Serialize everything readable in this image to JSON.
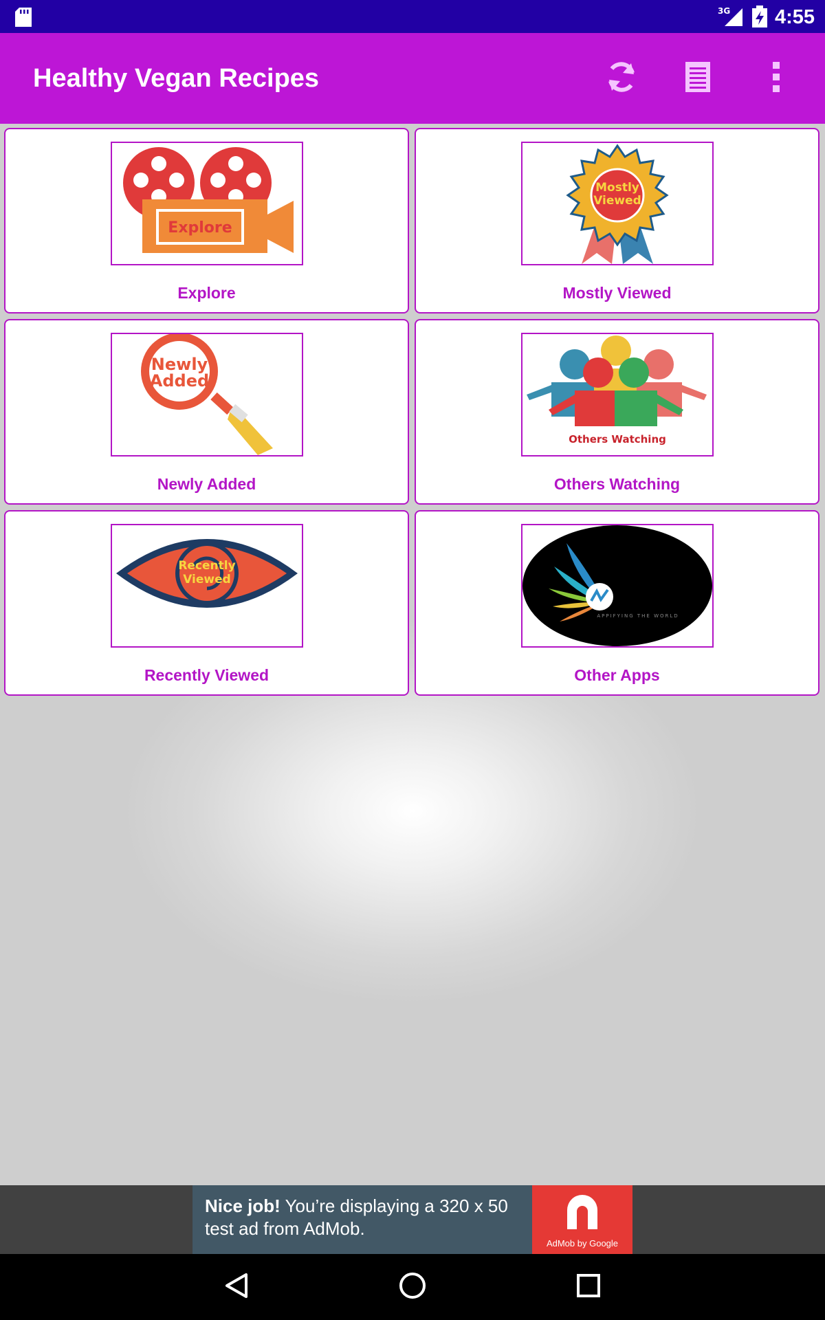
{
  "status_bar": {
    "time": "4:55",
    "network": "3G",
    "bg_color": "#2200a4"
  },
  "app_bar": {
    "title": "Healthy Vegan Recipes",
    "bg_color": "#bd16d6",
    "actions": [
      "refresh-icon",
      "list-icon",
      "more-vertical-icon"
    ]
  },
  "grid": {
    "accent_color": "#b315c6",
    "cards": [
      {
        "label": "Explore",
        "image_text": "Explore",
        "icon": "film-camera-icon"
      },
      {
        "label": "Mostly Viewed",
        "image_text": "Mostly Viewed",
        "icon": "award-ribbon-icon"
      },
      {
        "label": "Newly Added",
        "image_text": "Newly Added",
        "icon": "magnifier-icon"
      },
      {
        "label": "Others Watching",
        "image_text": "Others Watching",
        "icon": "people-group-icon"
      },
      {
        "label": "Recently Viewed",
        "image_text": "Recently Viewed",
        "icon": "eye-icon"
      },
      {
        "label": "Other Apps",
        "image_text": "APPIFYING THE WORLD",
        "icon": "wings-logo-icon"
      }
    ]
  },
  "ad": {
    "headline": "Nice job!",
    "body": "You’re displaying a 320 x 50 test ad from AdMob.",
    "logo_label": "AdMob by Google"
  },
  "nav_bar": {
    "buttons": [
      "back-icon",
      "home-icon",
      "recents-icon"
    ]
  }
}
